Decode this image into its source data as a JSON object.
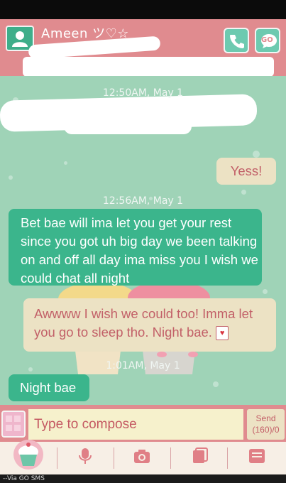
{
  "header": {
    "contact_name": "Ameen ツ♡☆",
    "icons": [
      "person-icon",
      "phone-icon",
      "go-icon"
    ],
    "go_label": "GO"
  },
  "messages": [
    {
      "type": "incoming",
      "text": ""
    },
    {
      "type": "timestamp",
      "text": "12:50AM, May 1"
    },
    {
      "type": "incoming",
      "text": ""
    },
    {
      "type": "outgoing",
      "text": "Yess!"
    },
    {
      "type": "timestamp",
      "text": "12:56AM, May 1"
    },
    {
      "type": "incoming",
      "text": "Bet bae will ima let you get your rest since you got uh big day we been talking on and off all day ima miss you I wish we could chat all night"
    },
    {
      "type": "outgoing",
      "text": "Awwww I wish we could too! Imma let you go to sleep tho. Night bae."
    },
    {
      "type": "timestamp",
      "text": "1:01AM, May 1"
    },
    {
      "type": "incoming",
      "text": "Night bae"
    }
  ],
  "composer": {
    "placeholder": "Type to compose",
    "send_label": "Send",
    "send_count": "(160)/0"
  },
  "toolbar": {
    "icons": [
      "cupcake-icon",
      "microphone-icon",
      "camera-icon",
      "attachment-icon",
      "mms-icon"
    ]
  },
  "footer": {
    "text": "--Via GO SMS"
  },
  "colors": {
    "header_bg": "#e08b8f",
    "chat_bg": "#9fd3b7",
    "incoming_bubble": "#3bb58c",
    "outgoing_bubble": "#ece2c4",
    "outgoing_text": "#c26068"
  }
}
